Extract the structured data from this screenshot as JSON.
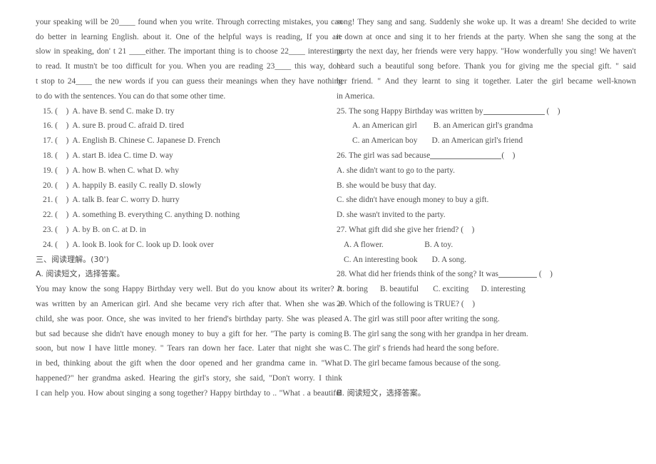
{
  "document": {
    "type": "english-exam-worksheet",
    "text_color": "#4d4d4d",
    "background_color": "#ffffff"
  },
  "left_column": {
    "cloze_passage": [
      "your speaking will be 20____ found when you write. Through correcting mistakes, you can",
      "do better in learning English.  about it. One of the helpful ways is reading, If you are",
      "slow in speaking, don' t 21 ____either. The important thing is to choose 22____ interesting",
      "to read. It mustn't be too difficult for you. When you are reading 23____ this way, don'",
      "t stop to 24____ the new words if you can guess their meanings when they have nothing",
      "to do with the sentences. You can do that some other time."
    ],
    "cloze_questions": [
      "15. (    )  A. have B. send C. make D. try",
      "16. (    )  A. sure B. proud C. afraid D. tired",
      "17. (    )  A. English B. Chinese C. Japanese D. French",
      "18. (    )  A. start B. idea C. time D. way",
      "19. (    )  A. how B. when C. what D. why",
      "20. (    )  A. happily B. easily C. really D. slowly",
      "21. (    )  A. talk B. fear C. worry D. hurry",
      "22. (    )  A. something B. everything C. anything D. nothing",
      "23. (    )  A. by B. on C. at D. in",
      "24. (    )  A. look B. look for C. look up D. look over"
    ],
    "section_heading": "三、阅读理解。(30')",
    "subsection_heading": "A. 阅读短文，选择答案。",
    "reading_passage": [
      "    You may know the song Happy Birthday very well. But do you know about its writer? It",
      "was written by an American girl. And she became very rich after that.  When she was a",
      "child, she was poor.  Once, she was invited to her friend's birthday party.  She was pleased",
      "but sad because she didn't have enough money to buy a gift for her.  \"The party is coming",
      "soon, but now I have little money. \" Tears ran down her face.  Later that night she was",
      "in bed, thinking about the gift when the door opened and her grandma came in.  \"What",
      "happened?\" her grandma asked.  Hearing the girl's story, she said, \"Don't worry. I think",
      "I can help you. How about singing a song together? Happy birthday to .. \"What .  a beautiful"
    ]
  },
  "right_column": {
    "reading_passage": [
      "song! They sang and sang.  Suddenly she woke up. It was a dream! She decided to write",
      "it down at once and sing it to her friends at the party.  When she sang the song at the",
      "party the next day, her friends were very happy. \"How wonderfully you sing! We haven't",
      "heard such a beautiful song before.  Thank you for giving me the special gift. \"  said",
      "her friend.  \" And they learnt to sing it together.  Later the girl became well-known",
      "in America."
    ],
    "questions": [
      {
        "stem_before": "25. The song Happy Birthday was written by",
        "blank": "long",
        "stem_after": " (    )",
        "options": [
          "A. an American girl        B. an American girl's grandma",
          "C. an American boy       D. an American girl's friend"
        ],
        "options_indent": true
      },
      {
        "stem_before": "26. The girl was sad because",
        "blank": "med",
        "stem_after": "(    )",
        "options": [
          "A. she didn't want to go to the party.",
          "B. she would be busy that day.",
          "C. she didn't have enough money to buy a gift.",
          "D. she wasn't invited to the party."
        ],
        "options_indent": false
      },
      {
        "stem_before": "27. What gift did she give her friend? (    )",
        "blank": "none",
        "stem_after": "",
        "options": [
          "A. A flower.                    B. A toy.",
          "C. An interesting book       D. A song."
        ],
        "options_indent": true
      },
      {
        "stem_before": "28. What did her friends think of the song? It was",
        "blank": "sm",
        "stem_after": " (    )",
        "options": [
          "A. boring      B. beautiful       C. exciting      D. interesting"
        ],
        "options_indent": false
      },
      {
        "stem_before": "29. Which of the following is TRUE? (    )",
        "blank": "none",
        "stem_after": "",
        "options": [
          "A. The girl was still poor after writing the song.",
          "B. The girl sang the song with her grandpa in her dream.",
          "C. The girl' s friends had heard the song before.",
          "D. The girl became famous because of the song."
        ],
        "options_indent": false
      }
    ],
    "subsection_heading": "B. 阅读短文，选择答案。"
  }
}
